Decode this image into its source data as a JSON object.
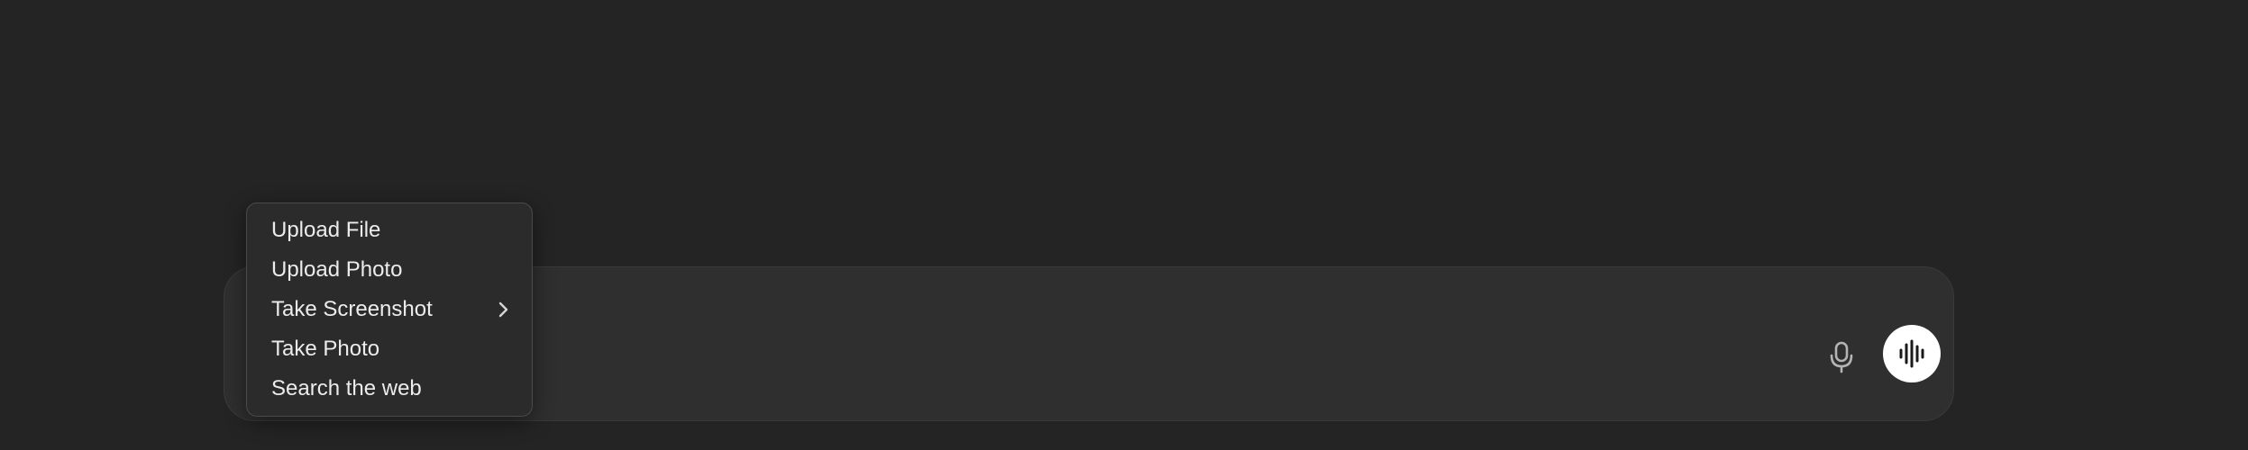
{
  "composer": {
    "input_value": "",
    "input_placeholder": "",
    "mic_icon": "microphone-icon",
    "voice_icon": "voice-waveform-icon"
  },
  "attach_menu": {
    "items": [
      {
        "label": "Upload File",
        "has_submenu": false
      },
      {
        "label": "Upload Photo",
        "has_submenu": false
      },
      {
        "label": "Take Screenshot",
        "has_submenu": true,
        "submenu_icon": "chevron-right-icon"
      },
      {
        "label": "Take Photo",
        "has_submenu": false
      },
      {
        "label": "Search the web",
        "has_submenu": false
      }
    ]
  },
  "colors": {
    "background": "#242424",
    "composer_bg": "#2f2f2f",
    "menu_bg": "#2b2b2b",
    "text": "#ececec",
    "voice_button_bg": "#ffffff",
    "voice_icon": "#1a1a1a"
  }
}
